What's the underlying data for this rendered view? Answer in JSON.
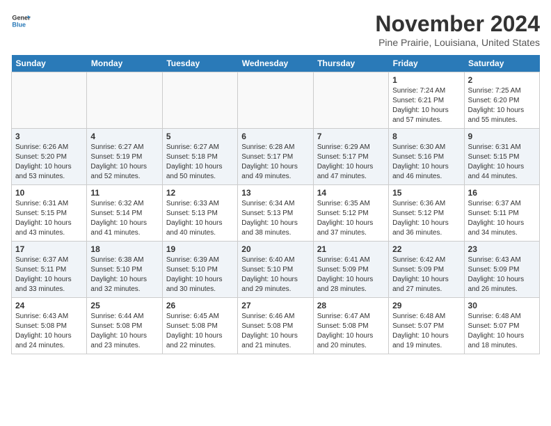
{
  "header": {
    "logo_line1": "General",
    "logo_line2": "Blue",
    "month": "November 2024",
    "location": "Pine Prairie, Louisiana, United States"
  },
  "weekdays": [
    "Sunday",
    "Monday",
    "Tuesday",
    "Wednesday",
    "Thursday",
    "Friday",
    "Saturday"
  ],
  "weeks": [
    [
      {
        "day": "",
        "info": ""
      },
      {
        "day": "",
        "info": ""
      },
      {
        "day": "",
        "info": ""
      },
      {
        "day": "",
        "info": ""
      },
      {
        "day": "",
        "info": ""
      },
      {
        "day": "1",
        "info": "Sunrise: 7:24 AM\nSunset: 6:21 PM\nDaylight: 10 hours and 57 minutes."
      },
      {
        "day": "2",
        "info": "Sunrise: 7:25 AM\nSunset: 6:20 PM\nDaylight: 10 hours and 55 minutes."
      }
    ],
    [
      {
        "day": "3",
        "info": "Sunrise: 6:26 AM\nSunset: 5:20 PM\nDaylight: 10 hours and 53 minutes."
      },
      {
        "day": "4",
        "info": "Sunrise: 6:27 AM\nSunset: 5:19 PM\nDaylight: 10 hours and 52 minutes."
      },
      {
        "day": "5",
        "info": "Sunrise: 6:27 AM\nSunset: 5:18 PM\nDaylight: 10 hours and 50 minutes."
      },
      {
        "day": "6",
        "info": "Sunrise: 6:28 AM\nSunset: 5:17 PM\nDaylight: 10 hours and 49 minutes."
      },
      {
        "day": "7",
        "info": "Sunrise: 6:29 AM\nSunset: 5:17 PM\nDaylight: 10 hours and 47 minutes."
      },
      {
        "day": "8",
        "info": "Sunrise: 6:30 AM\nSunset: 5:16 PM\nDaylight: 10 hours and 46 minutes."
      },
      {
        "day": "9",
        "info": "Sunrise: 6:31 AM\nSunset: 5:15 PM\nDaylight: 10 hours and 44 minutes."
      }
    ],
    [
      {
        "day": "10",
        "info": "Sunrise: 6:31 AM\nSunset: 5:15 PM\nDaylight: 10 hours and 43 minutes."
      },
      {
        "day": "11",
        "info": "Sunrise: 6:32 AM\nSunset: 5:14 PM\nDaylight: 10 hours and 41 minutes."
      },
      {
        "day": "12",
        "info": "Sunrise: 6:33 AM\nSunset: 5:13 PM\nDaylight: 10 hours and 40 minutes."
      },
      {
        "day": "13",
        "info": "Sunrise: 6:34 AM\nSunset: 5:13 PM\nDaylight: 10 hours and 38 minutes."
      },
      {
        "day": "14",
        "info": "Sunrise: 6:35 AM\nSunset: 5:12 PM\nDaylight: 10 hours and 37 minutes."
      },
      {
        "day": "15",
        "info": "Sunrise: 6:36 AM\nSunset: 5:12 PM\nDaylight: 10 hours and 36 minutes."
      },
      {
        "day": "16",
        "info": "Sunrise: 6:37 AM\nSunset: 5:11 PM\nDaylight: 10 hours and 34 minutes."
      }
    ],
    [
      {
        "day": "17",
        "info": "Sunrise: 6:37 AM\nSunset: 5:11 PM\nDaylight: 10 hours and 33 minutes."
      },
      {
        "day": "18",
        "info": "Sunrise: 6:38 AM\nSunset: 5:10 PM\nDaylight: 10 hours and 32 minutes."
      },
      {
        "day": "19",
        "info": "Sunrise: 6:39 AM\nSunset: 5:10 PM\nDaylight: 10 hours and 30 minutes."
      },
      {
        "day": "20",
        "info": "Sunrise: 6:40 AM\nSunset: 5:10 PM\nDaylight: 10 hours and 29 minutes."
      },
      {
        "day": "21",
        "info": "Sunrise: 6:41 AM\nSunset: 5:09 PM\nDaylight: 10 hours and 28 minutes."
      },
      {
        "day": "22",
        "info": "Sunrise: 6:42 AM\nSunset: 5:09 PM\nDaylight: 10 hours and 27 minutes."
      },
      {
        "day": "23",
        "info": "Sunrise: 6:43 AM\nSunset: 5:09 PM\nDaylight: 10 hours and 26 minutes."
      }
    ],
    [
      {
        "day": "24",
        "info": "Sunrise: 6:43 AM\nSunset: 5:08 PM\nDaylight: 10 hours and 24 minutes."
      },
      {
        "day": "25",
        "info": "Sunrise: 6:44 AM\nSunset: 5:08 PM\nDaylight: 10 hours and 23 minutes."
      },
      {
        "day": "26",
        "info": "Sunrise: 6:45 AM\nSunset: 5:08 PM\nDaylight: 10 hours and 22 minutes."
      },
      {
        "day": "27",
        "info": "Sunrise: 6:46 AM\nSunset: 5:08 PM\nDaylight: 10 hours and 21 minutes."
      },
      {
        "day": "28",
        "info": "Sunrise: 6:47 AM\nSunset: 5:08 PM\nDaylight: 10 hours and 20 minutes."
      },
      {
        "day": "29",
        "info": "Sunrise: 6:48 AM\nSunset: 5:07 PM\nDaylight: 10 hours and 19 minutes."
      },
      {
        "day": "30",
        "info": "Sunrise: 6:48 AM\nSunset: 5:07 PM\nDaylight: 10 hours and 18 minutes."
      }
    ]
  ]
}
